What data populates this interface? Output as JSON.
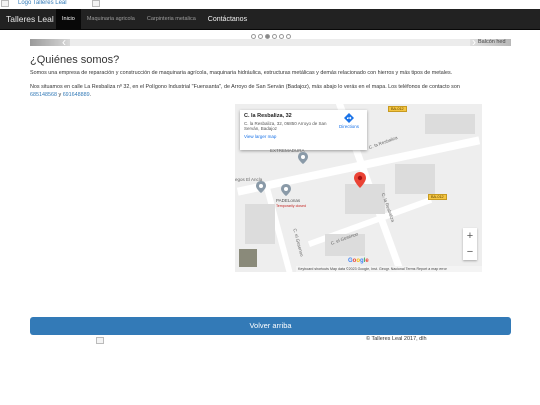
{
  "topbar": {
    "logo_alt": "Logo Talleres Leal"
  },
  "navbar": {
    "brand": "Talleres Leal",
    "items": [
      {
        "label": "Inicio",
        "active": true
      },
      {
        "label": "Maquinaria agricola",
        "active": false
      },
      {
        "label": "Carpinteria metalica",
        "active": false
      },
      {
        "label": "Contáctanos",
        "active": false
      }
    ]
  },
  "carousel": {
    "caption": "Balcón hed",
    "slide_count": 6,
    "active_index": 2
  },
  "about": {
    "title": "¿Quiénes somos?",
    "intro": "Somos una empresa de reparación y construcción de maquinaria agrícola, maquinaria hidráulica, estructuras metálicas y demás relacionado con hierros y más tipos de metales.",
    "location_text": "Nos situamos en calle La Resbaliza nº 32, en el Polígono Industrial \"Fuensanta\", de Arroyo de San Serván (Badajoz), más abajo lo verás en el mapa. Los teléfonos de contacto son",
    "phone1": "685148568",
    "and_word": "y",
    "phone2": "691648889",
    "end_punct": "."
  },
  "map": {
    "place_name": "C. la Resbaliza, 32",
    "place_address": "C. la Resbaliza, 32, 06850 Arroyo de San Serván, Badajoz",
    "directions_label": "Directions",
    "larger_map_label": "View larger map",
    "labels": {
      "extremadura": "EXTREMADURA",
      "el_ancla": "egos El Ancla",
      "padel_name": "PADELonas",
      "padel_status": "Temporarily closed",
      "street1": "C. la Resbaliza",
      "street2": "C. la Resbaliza",
      "street3": "C. el Gesenoo",
      "street4": "C. el Gesenoo",
      "road1": "BA-012",
      "road2": "BA-012"
    },
    "zoom_in": "+",
    "zoom_out": "−",
    "google_logo": "Google",
    "attribution": "Keyboard shortcuts   Map data ©2023 Google, Inst. Geogr. Nacional   Terms   Report a map error"
  },
  "back_to_top": "Volver arriba",
  "footer": {
    "text": "© Talleres Leal 2017, dlh"
  },
  "colors": {
    "primary": "#337ab7",
    "navbar": "#222222",
    "marker": "#ea4335"
  }
}
